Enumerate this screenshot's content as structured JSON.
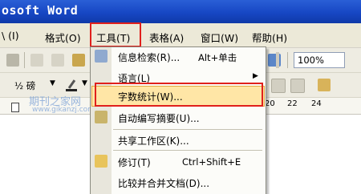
{
  "window": {
    "title": "osoft Word"
  },
  "menubar": {
    "items": [
      {
        "label": "\\ (I)"
      },
      {
        "label": "格式(O)"
      },
      {
        "label": "工具(T)"
      },
      {
        "label": "表格(A)"
      },
      {
        "label": "窗口(W)"
      },
      {
        "label": "帮助(H)"
      }
    ]
  },
  "toolbar": {
    "zoom": "100%"
  },
  "formatting": {
    "font_size": "½ 磅"
  },
  "ruler": {
    "ticks": [
      "20",
      "22",
      "24"
    ]
  },
  "tools_menu": {
    "items": [
      {
        "label": "信息检索(R)...",
        "shortcut": "Alt+单击"
      },
      {
        "label": "语言(L)"
      },
      {
        "label": "字数统计(W)..."
      },
      {
        "label": "自动编写摘要(U)..."
      },
      {
        "label": "共享工作区(K)..."
      },
      {
        "label": "修订(T)",
        "shortcut": "Ctrl+Shift+E"
      },
      {
        "label": "比较并合并文档(D)..."
      }
    ]
  },
  "watermark": {
    "text": "期刊之家网",
    "url": "www.gikanzj.com"
  },
  "colors": {
    "titlebar": "#1747c4",
    "highlight": "#ffe6a6",
    "callout": "#e0201c"
  }
}
